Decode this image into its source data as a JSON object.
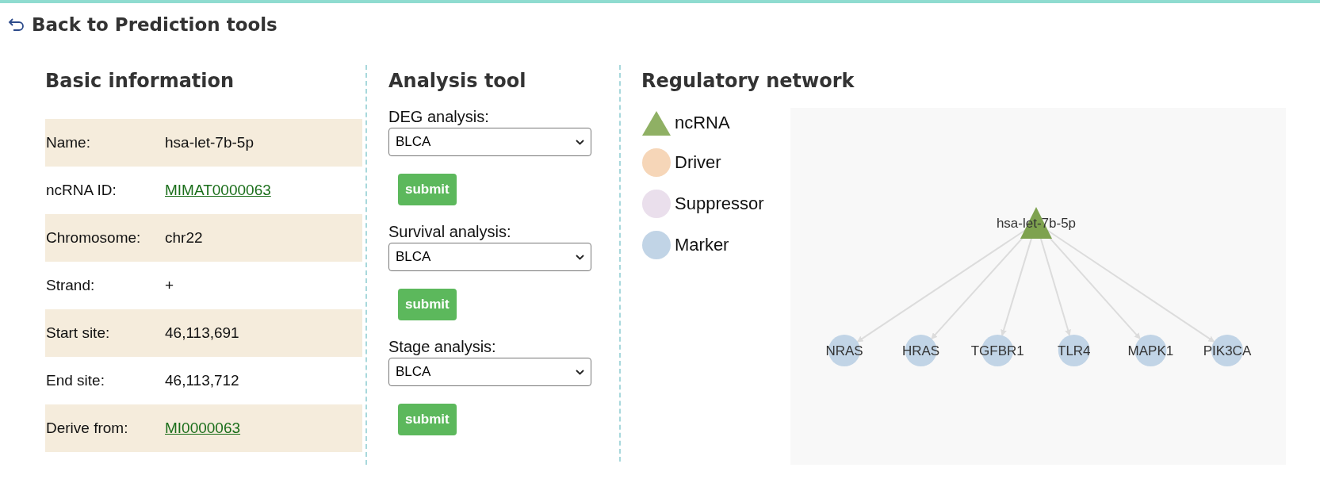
{
  "back_link": {
    "label": "Back to Prediction tools"
  },
  "basic_information": {
    "title": "Basic information",
    "rows": [
      {
        "label": "Name:",
        "value": "hsa-let-7b-5p",
        "kind": "text"
      },
      {
        "label": "ncRNA ID:",
        "value": "MIMAT0000063",
        "kind": "link"
      },
      {
        "label": "Chromosome:",
        "value": "chr22",
        "kind": "text"
      },
      {
        "label": "Strand:",
        "value": "+",
        "kind": "text"
      },
      {
        "label": "Start site:",
        "value": "46,113,691",
        "kind": "text"
      },
      {
        "label": "End site:",
        "value": "46,113,712",
        "kind": "text"
      },
      {
        "label": "Derive from:",
        "value": "MI0000063",
        "kind": "link"
      }
    ]
  },
  "analysis_tool": {
    "title": "Analysis tool",
    "forms": [
      {
        "label": "DEG analysis:",
        "value": "BLCA",
        "button": "submit"
      },
      {
        "label": "Survival analysis:",
        "value": "BLCA",
        "button": "submit"
      },
      {
        "label": "Stage analysis:",
        "value": "BLCA",
        "button": "submit"
      }
    ]
  },
  "regulatory_network": {
    "title": "Regulatory network",
    "legend": [
      {
        "label": "ncRNA",
        "kind": "triangle",
        "color": "#8fb064"
      },
      {
        "label": "Driver",
        "kind": "circle",
        "color": "#f6d6b8"
      },
      {
        "label": "Suppressor",
        "kind": "circle",
        "color": "#eadfec"
      },
      {
        "label": "Marker",
        "kind": "circle",
        "color": "#c1d4e6"
      }
    ],
    "root": {
      "label": "hsa-let-7b-5p",
      "color": "#7ea24f"
    },
    "targets": [
      {
        "label": "NRAS",
        "color": "#c1d4e6"
      },
      {
        "label": "HRAS",
        "color": "#c1d4e6"
      },
      {
        "label": "TGFBR1",
        "color": "#c1d4e6"
      },
      {
        "label": "TLR4",
        "color": "#c1d4e6"
      },
      {
        "label": "MAPK1",
        "color": "#c1d4e6"
      },
      {
        "label": "PIK3CA",
        "color": "#c1d4e6"
      }
    ]
  }
}
